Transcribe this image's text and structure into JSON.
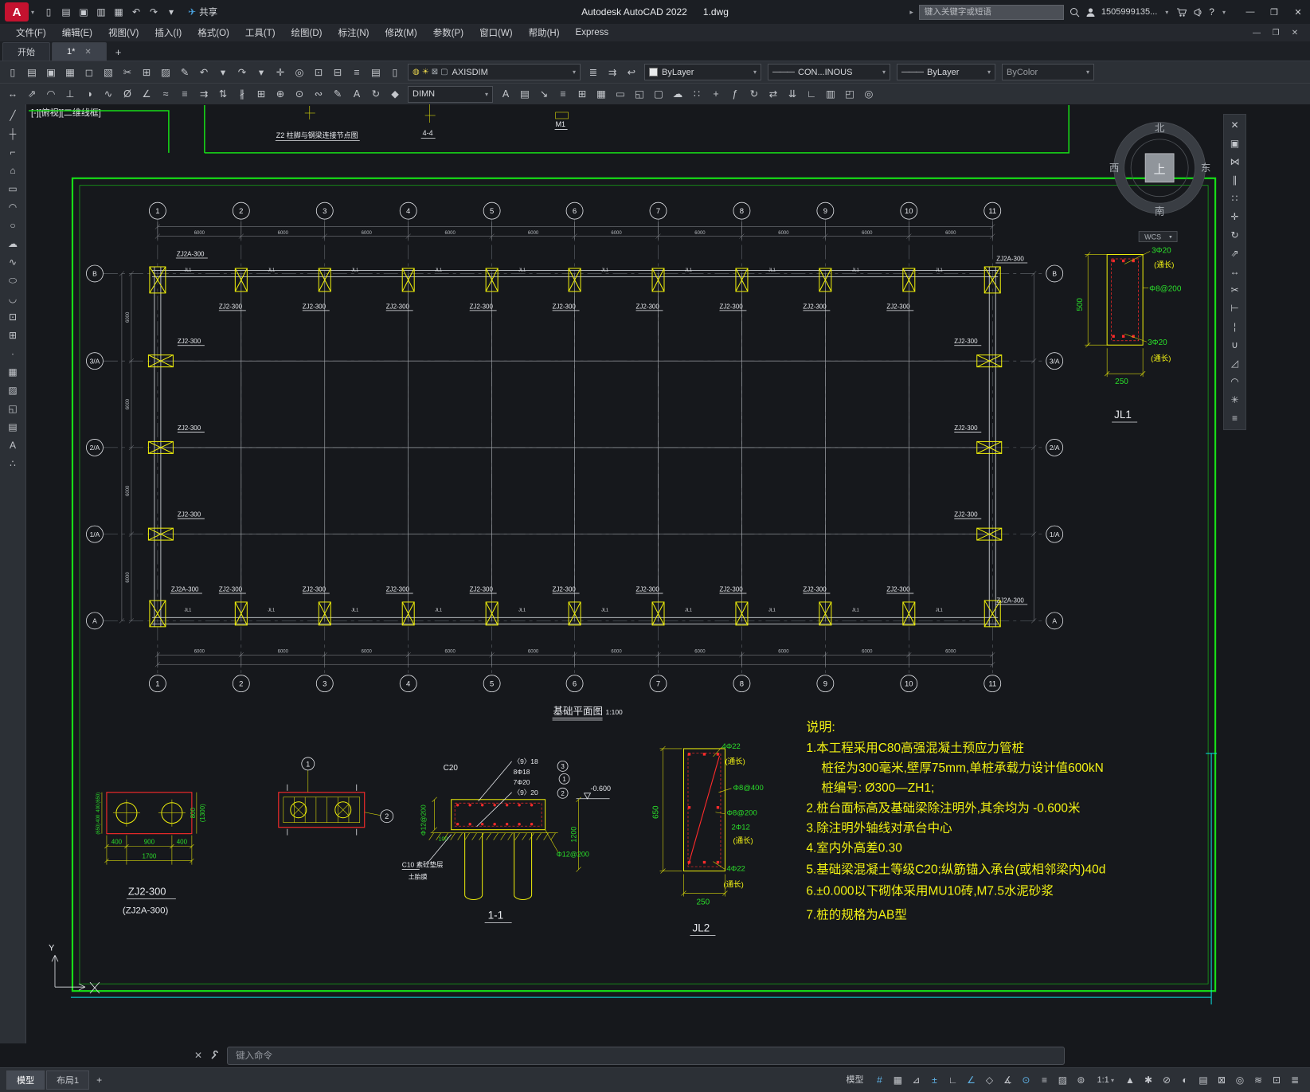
{
  "titlebar": {
    "logo": "A",
    "share_label": "共享",
    "title": "Autodesk AutoCAD 2022",
    "doc": "1.dwg",
    "search_placeholder": "键入关键字或短语",
    "account": "1505999135...",
    "window": {
      "min": "—",
      "max": "❐",
      "close": "✕"
    },
    "quick_access": [
      {
        "name": "new-file-icon",
        "glyph": "▯"
      },
      {
        "name": "open-file-icon",
        "glyph": "▤"
      },
      {
        "name": "save-icon",
        "glyph": "▣"
      },
      {
        "name": "save-as-icon",
        "glyph": "▥"
      },
      {
        "name": "plot-icon",
        "glyph": "▦"
      },
      {
        "name": "undo-icon",
        "glyph": "↶"
      },
      {
        "name": "redo-icon",
        "glyph": "↷"
      },
      {
        "name": "qa-dropdown-icon",
        "glyph": "▾"
      }
    ]
  },
  "menubar": [
    "文件(F)",
    "编辑(E)",
    "视图(V)",
    "插入(I)",
    "格式(O)",
    "工具(T)",
    "绘图(D)",
    "标注(N)",
    "修改(M)",
    "参数(P)",
    "窗口(W)",
    "帮助(H)",
    "Express"
  ],
  "tabs": {
    "start": "开始",
    "doc": "1*",
    "close": "✕",
    "plus": "+"
  },
  "toolbar1": {
    "layer": "AXISDIM",
    "color": "ByLayer",
    "linetype_dash": "———",
    "linetype": "CON...INOUS",
    "lineweight_dash": "———",
    "lineweight": "ByLayer",
    "plotstyle": "ByColor",
    "icons_a": [
      {
        "name": "new-icon",
        "glyph": "▯"
      },
      {
        "name": "open-icon",
        "glyph": "▤"
      },
      {
        "name": "save-icon",
        "glyph": "▣"
      },
      {
        "name": "plot-icon",
        "glyph": "▦"
      },
      {
        "name": "plot-preview-icon",
        "glyph": "◻"
      },
      {
        "name": "publish-icon",
        "glyph": "▧"
      },
      {
        "name": "cut-icon",
        "glyph": "✂"
      },
      {
        "name": "copy-icon",
        "glyph": "⊞"
      },
      {
        "name": "paste-icon",
        "glyph": "▨"
      },
      {
        "name": "match-properties-icon",
        "glyph": "✎"
      },
      {
        "name": "undo-icon",
        "glyph": "↶"
      },
      {
        "name": "undo-list-icon",
        "glyph": "▾"
      },
      {
        "name": "redo-icon",
        "glyph": "↷"
      },
      {
        "name": "redo-list-icon",
        "glyph": "▾"
      },
      {
        "name": "pan-icon",
        "glyph": "✛"
      },
      {
        "name": "zoom-realtime-icon",
        "glyph": "◎"
      },
      {
        "name": "zoom-window-icon",
        "glyph": "⊡"
      },
      {
        "name": "zoom-previous-icon",
        "glyph": "⊟"
      },
      {
        "name": "properties-icon",
        "glyph": "≡"
      },
      {
        "name": "design-center-icon",
        "glyph": "▤"
      },
      {
        "name": "tool-palettes-icon",
        "glyph": "▯"
      }
    ],
    "layer_icons": [
      {
        "name": "layer-on-icon",
        "glyph": "◍",
        "cls": "b"
      },
      {
        "name": "layer-thaw-icon",
        "glyph": "☀",
        "cls": "s"
      },
      {
        "name": "layer-lock-icon",
        "glyph": "⊠",
        "cls": "l"
      },
      {
        "name": "layer-color-swatch",
        "glyph": "▢",
        "cls": "l"
      }
    ],
    "icons_b": [
      {
        "name": "layer-properties-icon",
        "glyph": "≣"
      },
      {
        "name": "layer-match-icon",
        "glyph": "⇉"
      },
      {
        "name": "layer-previous-icon",
        "glyph": "↩"
      }
    ]
  },
  "toolbar2": {
    "dimstyle": "DIMN",
    "icons_a": [
      {
        "name": "dim-linear-icon",
        "glyph": "↔"
      },
      {
        "name": "dim-aligned-icon",
        "glyph": "⇗"
      },
      {
        "name": "dim-arc-length-icon",
        "glyph": "◠"
      },
      {
        "name": "dim-ordinate-icon",
        "glyph": "⊥"
      },
      {
        "name": "dim-radius-icon",
        "glyph": "◑"
      },
      {
        "name": "dim-jogged-icon",
        "glyph": "∿"
      },
      {
        "name": "dim-diameter-icon",
        "glyph": "Ø"
      },
      {
        "name": "dim-angular-icon",
        "glyph": "∠"
      },
      {
        "name": "quick-dim-icon",
        "glyph": "≈"
      },
      {
        "name": "dim-baseline-icon",
        "glyph": "≡"
      },
      {
        "name": "dim-continue-icon",
        "glyph": "⇉"
      },
      {
        "name": "dim-space-icon",
        "glyph": "⇅"
      },
      {
        "name": "dim-break-icon",
        "glyph": "∦"
      },
      {
        "name": "tolerance-icon",
        "glyph": "⊞"
      },
      {
        "name": "center-mark-icon",
        "glyph": "⊕"
      },
      {
        "name": "dim-inspect-icon",
        "glyph": "⊙"
      },
      {
        "name": "dim-jog-line-icon",
        "glyph": "∾"
      },
      {
        "name": "dim-edit-icon",
        "glyph": "✎"
      },
      {
        "name": "dim-text-edit-icon",
        "glyph": "A"
      },
      {
        "name": "dim-update-icon",
        "glyph": "↻"
      },
      {
        "name": "dim-style-icon",
        "glyph": "◆"
      }
    ],
    "icons_b": [
      {
        "name": "mtext-icon",
        "glyph": "A"
      },
      {
        "name": "table-icon",
        "glyph": "▤"
      },
      {
        "name": "mleader-icon",
        "glyph": "↘"
      },
      {
        "name": "mleader-align-icon",
        "glyph": "≡"
      },
      {
        "name": "mleader-collect-icon",
        "glyph": "⊞"
      },
      {
        "name": "hatch-icon",
        "glyph": "▦"
      },
      {
        "name": "boundary-icon",
        "glyph": "▭"
      },
      {
        "name": "region-icon",
        "glyph": "◱"
      },
      {
        "name": "wipeout-icon",
        "glyph": "▢"
      },
      {
        "name": "revision-cloud-icon",
        "glyph": "☁"
      },
      {
        "name": "measure-icon",
        "glyph": "∷"
      },
      {
        "name": "quick-calc-icon",
        "glyph": "+"
      },
      {
        "name": "field-icon",
        "glyph": "ƒ"
      },
      {
        "name": "update-field-icon",
        "glyph": "↻"
      },
      {
        "name": "data-link-icon",
        "glyph": "⇄"
      },
      {
        "name": "extract-data-icon",
        "glyph": "⇊"
      },
      {
        "name": "ucs-icon",
        "glyph": "∟"
      },
      {
        "name": "named-views-icon",
        "glyph": "▥"
      },
      {
        "name": "viewports-icon",
        "glyph": "◰"
      },
      {
        "name": "orbit-icon",
        "glyph": "◎"
      }
    ]
  },
  "palette_left": [
    {
      "name": "line-icon",
      "glyph": "╱"
    },
    {
      "name": "construction-line-icon",
      "glyph": "┼"
    },
    {
      "name": "polyline-icon",
      "glyph": "⌐"
    },
    {
      "name": "polygon-icon",
      "glyph": "⌂"
    },
    {
      "name": "rectangle-icon",
      "glyph": "▭"
    },
    {
      "name": "arc-icon",
      "glyph": "◠"
    },
    {
      "name": "circle-icon",
      "glyph": "○"
    },
    {
      "name": "revision-cloud-icon",
      "glyph": "☁"
    },
    {
      "name": "spline-icon",
      "glyph": "∿"
    },
    {
      "name": "ellipse-icon",
      "glyph": "⬭"
    },
    {
      "name": "ellipse-arc-icon",
      "glyph": "◡"
    },
    {
      "name": "insert-block-icon",
      "glyph": "⊡"
    },
    {
      "name": "create-block-icon",
      "glyph": "⊞"
    },
    {
      "name": "point-icon",
      "glyph": "∙"
    },
    {
      "name": "hatch-icon",
      "glyph": "▦"
    },
    {
      "name": "gradient-icon",
      "glyph": "▨"
    },
    {
      "name": "region-icon",
      "glyph": "◱"
    },
    {
      "name": "table-icon",
      "glyph": "▤"
    },
    {
      "name": "multiline-text-icon",
      "glyph": "A"
    },
    {
      "name": "point-style-icon",
      "glyph": "∴"
    }
  ],
  "palette_right": [
    {
      "name": "erase-icon",
      "glyph": "✕"
    },
    {
      "name": "copy-icon",
      "glyph": "▣"
    },
    {
      "name": "mirror-icon",
      "glyph": "⋈"
    },
    {
      "name": "offset-icon",
      "glyph": "∥"
    },
    {
      "name": "array-icon",
      "glyph": "∷"
    },
    {
      "name": "move-icon",
      "glyph": "✛"
    },
    {
      "name": "rotate-icon",
      "glyph": "↻"
    },
    {
      "name": "scale-icon",
      "glyph": "⇗"
    },
    {
      "name": "stretch-icon",
      "glyph": "↔"
    },
    {
      "name": "trim-icon",
      "glyph": "✂"
    },
    {
      "name": "extend-icon",
      "glyph": "⊢"
    },
    {
      "name": "break-icon",
      "glyph": "¦"
    },
    {
      "name": "join-icon",
      "glyph": "∪"
    },
    {
      "name": "chamfer-icon",
      "glyph": "◿"
    },
    {
      "name": "fillet-icon",
      "glyph": "◠"
    },
    {
      "name": "explode-icon",
      "glyph": "✳"
    },
    {
      "name": "modify-properties-icon",
      "glyph": "≡"
    }
  ],
  "canvas": {
    "viewport_label": "[-][俯视][二维线框]",
    "compass": {
      "n": "北",
      "s": "南",
      "w": "西",
      "e": "东",
      "up": "上",
      "wcs": "WCS"
    },
    "top": {
      "z2": "Z2 柱脚与钢梁连接节点图",
      "s44": "4-4",
      "m1": "M1"
    },
    "plan": {
      "title": "基础平面图",
      "scale": "1:100",
      "cols": [
        "1",
        "2",
        "3",
        "4",
        "5",
        "6",
        "7",
        "8",
        "9",
        "10",
        "11"
      ],
      "rows": [
        "B",
        "3/A",
        "2/A",
        "1/A",
        "A"
      ],
      "pile": "ZJ2-300",
      "pile_corner": "ZJ2A-300",
      "beam": "JL1",
      "bay": "6000",
      "bay_side": "6000"
    },
    "details": {
      "jl1": {
        "title": "JL1",
        "height": "500",
        "width": "250",
        "top": "3Φ20",
        "top_note": "(通长)",
        "stirrup": "Φ8@200",
        "bottom": "3Φ20",
        "bottom_note": "(通长)"
      },
      "zj2_plan": {
        "title": "ZJ2-300",
        "subtitle": "(ZJ2A-300)",
        "dims_bottom": [
          "400",
          "900",
          "400"
        ],
        "dim_total": "1700",
        "dims_right": [
          "800",
          "(1300)"
        ],
        "dims_left": [
          "(650)",
          "400",
          "400",
          "(650)"
        ]
      },
      "beam_plan": {
        "callout1": "1",
        "callout2": "2"
      },
      "section": {
        "title": "1-1",
        "concrete": "C20",
        "rebar": [
          "〈9〉18",
          "8Φ18",
          "7Φ20",
          "〈9〉20"
        ],
        "callouts": [
          "3",
          "1",
          "2"
        ],
        "level": "-0.600",
        "depth": "1200",
        "stirrup": "Φ12@200",
        "stirrup_left": "Φ12@200",
        "dim_small": "100",
        "bedding": "C10 素砼垫层",
        "formwork": "土胎膜"
      },
      "jl2": {
        "title": "JL2",
        "height": "650",
        "width": "250",
        "bars": [
          {
            "t": "4Φ22",
            "c": "g"
          },
          {
            "t": "(通长)",
            "c": "y"
          },
          {
            "t": "Φ8@400",
            "c": "g"
          },
          {
            "t": "Φ8@200",
            "c": "g"
          },
          {
            "t": "2Φ12",
            "c": "g"
          },
          {
            "t": "(通长)",
            "c": "y"
          },
          {
            "t": "4Φ22",
            "c": "g"
          },
          {
            "t": "(通长)",
            "c": "y"
          }
        ]
      }
    },
    "notes": {
      "title": "说明:",
      "lines": [
        "1.本工程采用C80高强混凝土预应力管桩",
        "桩径为300毫米,壁厚75mm,单桩承载力设计值600kN",
        "桩编号: Ø300—ZH1;",
        "2.桩台面标高及基础梁除注明外,其余均为 -0.600米",
        "3.除注明外轴线对承台中心",
        "4.室内外高差0.30",
        "5.基础梁混凝土等级C20;纵筋锚入承台(或相邻梁内)40d",
        "6.±0.000以下砌体采用MU10砖,M7.5水泥砂浆",
        "7.桩的规格为AB型"
      ]
    },
    "ucs": {
      "axis": "Y"
    }
  },
  "commandline": {
    "close": "✕",
    "placeholder": "键入命令"
  },
  "statusbar": {
    "model_tab": "模型",
    "layout_tab": "布局1",
    "plus": "+",
    "right_items": [
      {
        "name": "model-space-button",
        "label": "模型"
      },
      {
        "name": "grid-display-icon",
        "glyph": "#",
        "active": true
      },
      {
        "name": "snap-mode-icon",
        "glyph": "▦"
      },
      {
        "name": "infer-constraints-icon",
        "glyph": "⊿"
      },
      {
        "name": "dynamic-input-icon",
        "glyph": "±",
        "active": true
      },
      {
        "name": "ortho-mode-icon",
        "glyph": "∟"
      },
      {
        "name": "polar-tracking-icon",
        "glyph": "∠",
        "active": true
      },
      {
        "name": "isometric-drafting-icon",
        "glyph": "◇"
      },
      {
        "name": "object-snap-tracking-icon",
        "glyph": "∡"
      },
      {
        "name": "object-snap-icon",
        "glyph": "⊙",
        "active": true
      },
      {
        "name": "lineweight-icon",
        "glyph": "≡"
      },
      {
        "name": "transparency-icon",
        "glyph": "▨"
      },
      {
        "name": "selection-cycling-icon",
        "glyph": "⊚"
      },
      {
        "name": "annotation-scale-button",
        "label": "1:1",
        "arrow": true
      },
      {
        "name": "annotation-visibility-icon",
        "glyph": "▲"
      },
      {
        "name": "workspace-switching-icon",
        "glyph": "✱"
      },
      {
        "name": "annotation-monitor-icon",
        "glyph": "⊘"
      },
      {
        "name": "units-icon",
        "glyph": "◐"
      },
      {
        "name": "quick-properties-icon",
        "glyph": "▤"
      },
      {
        "name": "lock-ui-icon",
        "glyph": "⊠"
      },
      {
        "name": "isolate-objects-icon",
        "glyph": "◎"
      },
      {
        "name": "graphics-performance-icon",
        "glyph": "≋"
      },
      {
        "name": "clean-screen-icon",
        "glyph": "⊡"
      },
      {
        "name": "customization-icon",
        "glyph": "≣"
      }
    ]
  }
}
